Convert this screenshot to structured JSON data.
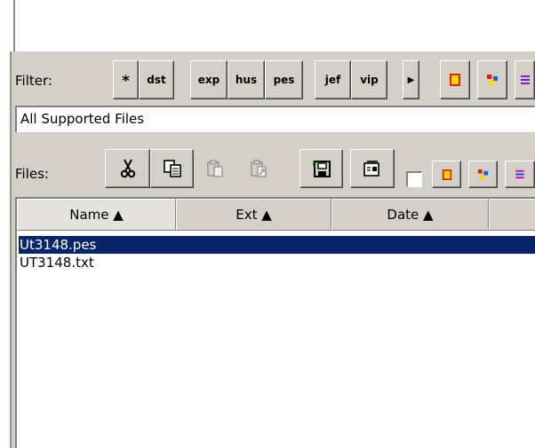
{
  "filter": {
    "label": "Filter:",
    "buttons": [
      "*",
      "dst",
      "exp",
      "hus",
      "pes",
      "jef",
      "vip"
    ],
    "more_icon": "play-right-icon"
  },
  "file_type": {
    "value": "All Supported Files"
  },
  "files": {
    "label": "Files:",
    "toolbar_icons": [
      "cut-icon",
      "copy-icon",
      "paste-icon",
      "paste-shortcut-icon",
      "save-icon",
      "properties-icon"
    ]
  },
  "columns": [
    "Name ▲",
    "Ext ▲",
    "Date ▲"
  ],
  "file_list": [
    {
      "name": "Ut3148.pes",
      "selected": true
    },
    {
      "name": "UT3148.txt",
      "selected": false
    }
  ],
  "colors": {
    "selection": "#0a246a",
    "panel": "#d4d0c8"
  }
}
